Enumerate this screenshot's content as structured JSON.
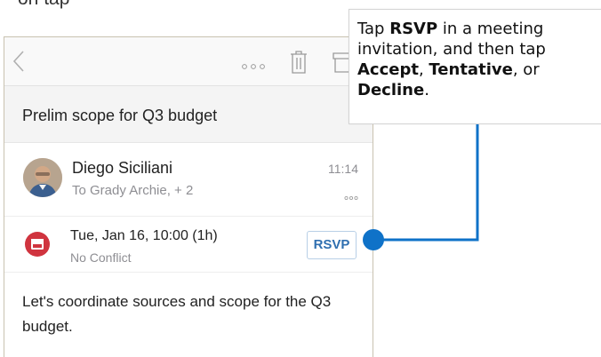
{
  "page": {
    "top_text": "on tap"
  },
  "toolbar": {
    "back_icon": "chevron-left-icon",
    "more_icon": "more-horizontal-icon",
    "trash_icon": "trash-icon",
    "archive_icon": "archive-icon"
  },
  "email": {
    "subject": "Prelim scope for Q3 budget",
    "sender": "Diego Siciliani",
    "recipients": "To Grady Archie, + 2",
    "time": "11:14",
    "body": "Let's coordinate sources and scope for the Q3 budget."
  },
  "meeting": {
    "datetime": "Tue, Jan 16, 10:00 (1h)",
    "conflict": "No Conflict",
    "rsvp_label": "RSVP",
    "icon": "calendar-icon"
  },
  "callout": {
    "part1": "Tap ",
    "rsvp": "RSVP",
    "part2": " in a meeting invitation, and then tap ",
    "accept": "Accept",
    "sep1": ", ",
    "tentative": "Tentative",
    "sep2": ", or ",
    "decline": "Decline",
    "end": "."
  },
  "colors": {
    "accent": "#0f72c8",
    "calendar_red": "#d0343f",
    "rsvp_blue": "#2f6fb0"
  }
}
